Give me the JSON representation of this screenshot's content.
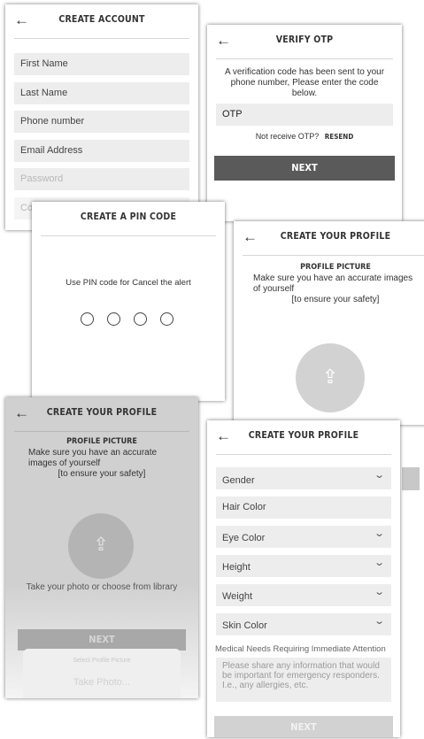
{
  "create_account": {
    "title": "CREATE ACCOUNT",
    "back": "←",
    "fields": [
      "First Name",
      "Last Name",
      "Phone number",
      "Email Address",
      "Password",
      "Co"
    ]
  },
  "verify_otp": {
    "title": "VERIFY OTP",
    "back": "←",
    "message": "A verification code has been sent to your phone number, Please enter the code below.",
    "otp_value": "OTP",
    "not_receive": "Not receive OTP?",
    "resend": "RESEND",
    "next": "NEXT"
  },
  "pin": {
    "title": "CREATE A PIN CODE",
    "instruction": "Use PIN code for Cancel the alert"
  },
  "profile_a": {
    "title": "CREATE YOUR PROFILE",
    "back": "←",
    "section": "PROFILE PICTURE",
    "desc": "Make sure you have an accurate images of yourself",
    "safety": "[to ensure your safety]",
    "upload": "⇪"
  },
  "profile_b": {
    "title": "CREATE YOUR PROFILE",
    "back": "←",
    "section": "PROFILE PICTURE",
    "desc": "Make sure you have an accurate images of yourself",
    "safety": "[to ensure your safety]",
    "upload": "⇪",
    "take_photo_hint": "Take your photo or choose from library",
    "next": "NEXT",
    "sheet_title": "Select Profile Picture",
    "sheet_option": "Take Photo..."
  },
  "profile_c": {
    "title": "CREATE YOUR PROFILE",
    "back": "←",
    "chevron": "⌄",
    "fields": [
      "Gender",
      "Hair Color",
      "Eye Color",
      "Height",
      "Weight",
      "Skin Color"
    ],
    "medical_label": "Medical Needs Requiring Immediate Attention",
    "medical_placeholder": "Please share any information that would be important for emergency responders. I.e., any allergies, etc.",
    "next": "NEXT"
  }
}
